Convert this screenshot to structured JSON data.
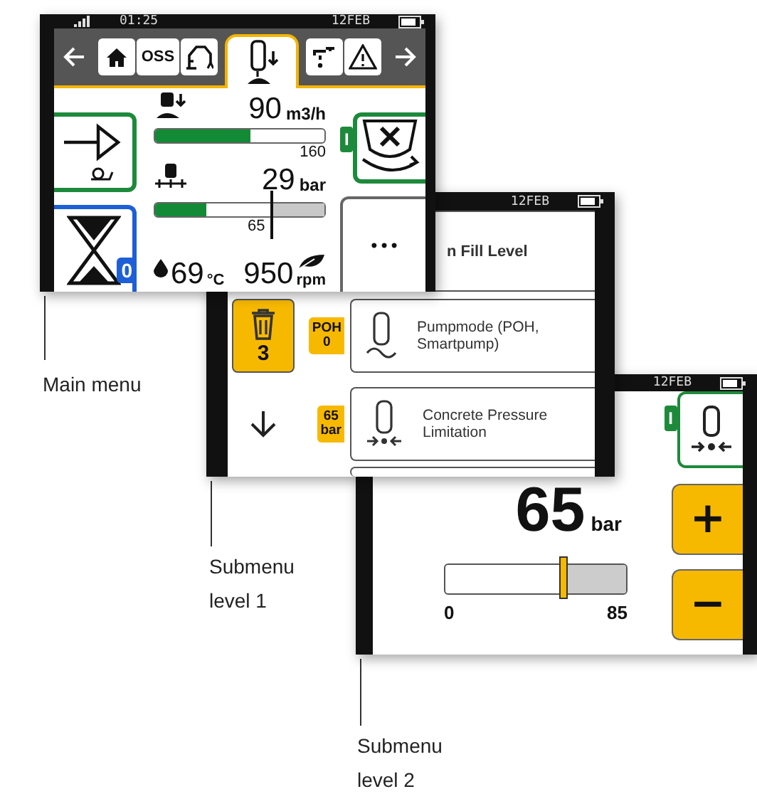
{
  "main_menu": {
    "caption": "Main menu",
    "status": {
      "time": "01:25",
      "date": "12FEB"
    },
    "tabs": [
      {
        "kind": "home",
        "selected": false
      },
      {
        "kind": "text",
        "label": "OSS",
        "selected": false
      },
      {
        "kind": "boom",
        "selected": false
      },
      {
        "kind": "pump",
        "selected": true
      },
      {
        "kind": "tap",
        "selected": false
      },
      {
        "kind": "warning",
        "selected": false
      }
    ],
    "mode_tab": "I",
    "hourglass_badge": "0",
    "flow": {
      "value": "90",
      "unit": "m3/h",
      "level": 0.56,
      "max": "160"
    },
    "pressure": {
      "value": "29",
      "unit": "bar",
      "level": 0.3,
      "limit": {
        "label": "65",
        "level": 0.68
      }
    },
    "temperature": {
      "value": "69",
      "unit": "°C"
    },
    "engine": {
      "value": "950",
      "unit": "rpm"
    },
    "more_button": "•••"
  },
  "submenu_1": {
    "caption": "Submenu level 1",
    "date": "12FEB",
    "trash_count": "3",
    "items": [
      {
        "kind": "level",
        "label": "n Fill Level"
      },
      {
        "kind": "mode",
        "label": "Pumpmode (POH, Smartpump)",
        "badge": [
          "POH",
          "0"
        ]
      },
      {
        "kind": "pressure",
        "label": "Concrete Pressure Limitation",
        "badge": [
          "65",
          "bar"
        ]
      },
      {
        "kind": "blank"
      }
    ]
  },
  "submenu_2": {
    "caption": "Submenu level 2",
    "date": "12FEB",
    "mode_tab": "I",
    "value": "65",
    "unit": "bar",
    "slider": {
      "level": 0.65,
      "min": "0",
      "max": "85"
    },
    "buttons": [
      "+",
      "−"
    ]
  }
}
